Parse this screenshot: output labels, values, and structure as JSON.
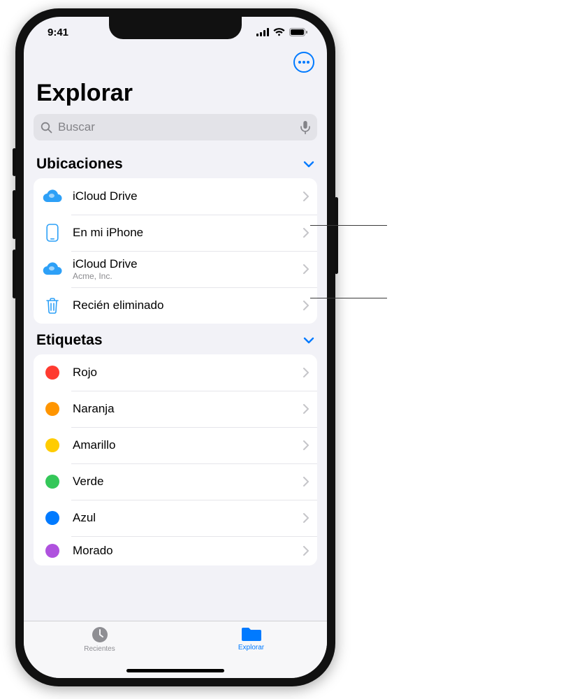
{
  "status": {
    "time": "9:41"
  },
  "page": {
    "title": "Explorar"
  },
  "search": {
    "placeholder": "Buscar"
  },
  "sections": {
    "locations": {
      "title": "Ubicaciones",
      "items": [
        {
          "label": "iCloud Drive",
          "sub": ""
        },
        {
          "label": "En mi iPhone",
          "sub": ""
        },
        {
          "label": "iCloud Drive",
          "sub": "Acme, Inc."
        },
        {
          "label": "Recién eliminado",
          "sub": ""
        }
      ]
    },
    "tags": {
      "title": "Etiquetas",
      "items": [
        {
          "label": "Rojo",
          "color": "#ff3b30"
        },
        {
          "label": "Naranja",
          "color": "#ff9500"
        },
        {
          "label": "Amarillo",
          "color": "#ffcc00"
        },
        {
          "label": "Verde",
          "color": "#34c759"
        },
        {
          "label": "Azul",
          "color": "#007aff"
        },
        {
          "label": "Morado",
          "color": "#af52de"
        }
      ]
    }
  },
  "tabs": {
    "recents": "Recientes",
    "browse": "Explorar"
  }
}
